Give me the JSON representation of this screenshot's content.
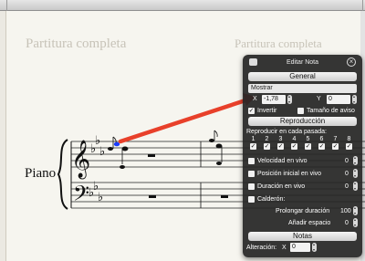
{
  "score": {
    "title_left": "Partitura completa",
    "title_right": "Partitura completa",
    "instrument": "Piano"
  },
  "panel": {
    "title": "Editar Nota",
    "general_header": "General",
    "show_select": "Mostrar",
    "x_label": "X",
    "x_value": "-1,78",
    "y_label": "Y",
    "y_value": "0",
    "invert_label": "Invertir",
    "warning_size_label": "Tamaño de aviso",
    "playback_header": "Reproducción",
    "play_each_pass_label": "Reproducir en cada pasada:",
    "voices": [
      "1",
      "2",
      "3",
      "4",
      "5",
      "6",
      "7",
      "8"
    ],
    "live_velocity_label": "Velocidad en vivo",
    "live_velocity_value": "0",
    "live_start_label": "Posición inicial en vivo",
    "live_start_value": "0",
    "live_duration_label": "Duración en vivo",
    "live_duration_value": "0",
    "fermata_label": "Calderón:",
    "extend_duration_label": "Prolongar duración",
    "extend_duration_value": "100",
    "add_space_label": "Añadir espacio",
    "add_space_value": "0",
    "notes_header": "Notas",
    "alteration_label": "Alteración:",
    "alteration_x_label": "X",
    "alteration_x_value": "0"
  },
  "colors": {
    "arrow": "#e8402a",
    "selected_note": "#1a3cff"
  }
}
